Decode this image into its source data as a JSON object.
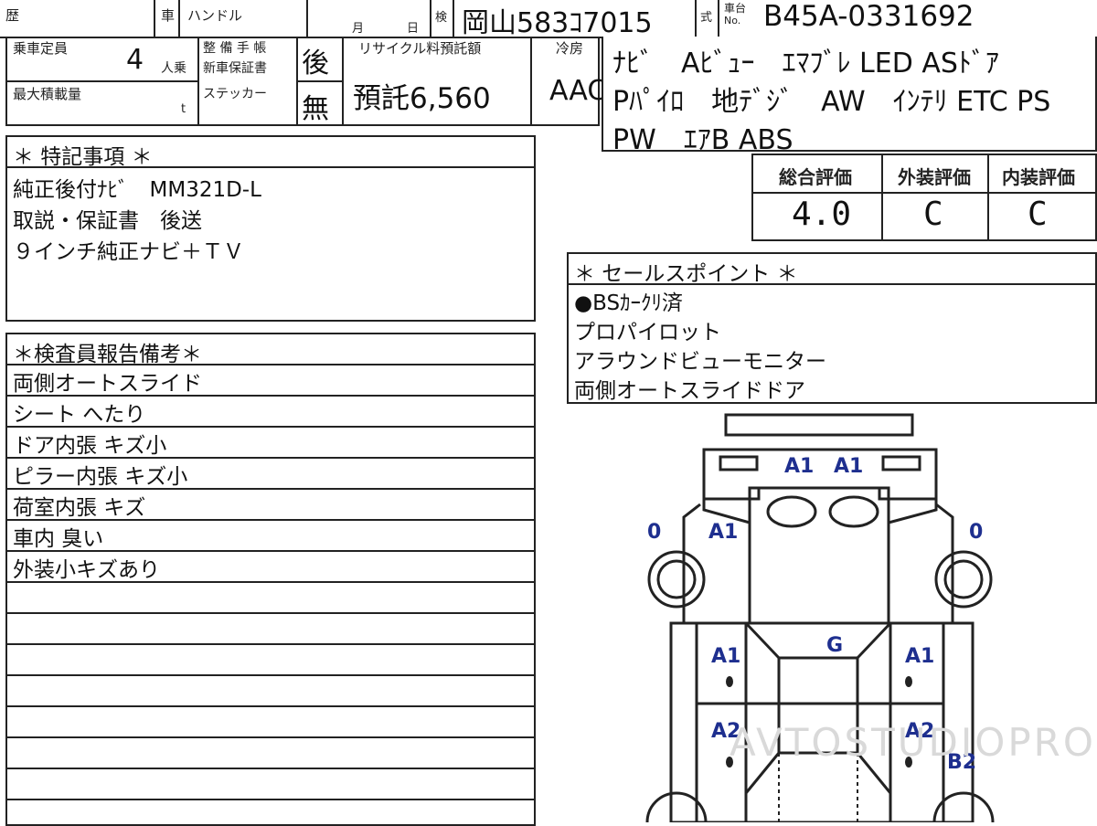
{
  "header": {
    "reki_label": "歴",
    "sha_label": "車",
    "handle_label": "ハンドル",
    "month_label": "月",
    "day_label": "日",
    "ken_label": "検",
    "plate": "岡山583ｺ7015",
    "shiki_label": "式",
    "chassis_label_top": "車台",
    "chassis_label_no": "No.",
    "chassis_no": "B45A-0331692"
  },
  "specs": {
    "capacity_label": "乗車定員",
    "capacity_value": "4",
    "capacity_unit": "人乗",
    "load_label": "最大積載量",
    "load_unit": "t",
    "warranty_label_1": "整 備 手 帳",
    "warranty_label_2": "新車保証書",
    "warranty_value": "後",
    "sticker_label": "ステッカー",
    "sticker_value": "無",
    "recycle_label": "リサイクル料預託額",
    "recycle_value": "預託6,560",
    "ac_label": "冷房",
    "ac_value": "AAC"
  },
  "equipment": {
    "lines": [
      "ﾅﾋﾞ　Aﾋﾞｭｰ　ｴﾏﾌﾞﾚ LED ASﾄﾞｱ",
      "Pﾊﾟｲﾛ　地ﾃﾞｼﾞ　AW　ｲﾝﾃﾘ ETC PS",
      "PW　ｴｱB ABS"
    ]
  },
  "ratings": {
    "overall_label": "総合評価",
    "overall_value": "4.0",
    "exterior_label": "外装評価",
    "exterior_value": "C",
    "interior_label": "内装評価",
    "interior_value": "C"
  },
  "notes": {
    "title": "＊ 特記事項 ＊",
    "lines": [
      "純正後付ﾅﾋﾞ　MM321D-L",
      "取説・保証書　後送",
      "９インチ純正ナビ＋ＴＶ"
    ]
  },
  "sales_points": {
    "title": "＊ セールスポイント ＊",
    "items": [
      "●BSｶｰｸﾘ済",
      "プロパイロット",
      "アラウンドビューモニター",
      "両側オートスライドドア"
    ]
  },
  "inspector": {
    "title": "＊検査員報告備考＊",
    "rows": [
      "両側オートスライド",
      "シート へたり",
      "ドア内張 キズ小",
      "ピラー内張 キズ小",
      "荷室内張 キズ",
      "車内 臭い",
      "外装小キズあり",
      "",
      "",
      "",
      "",
      "",
      "",
      "",
      ""
    ]
  },
  "diagram": {
    "marks": {
      "front_left": "A1",
      "front_right": "A1",
      "tire_fl": "0",
      "tire_fr": "0",
      "fender_l": "A1",
      "roof": "G",
      "door_fl": "A1",
      "door_fr": "A1",
      "door_rl": "A2",
      "door_rr": "A2",
      "rear_r": "B2"
    },
    "mark_color": "#1e2f8f"
  },
  "watermark": "AVTOSTUDIOPRO"
}
